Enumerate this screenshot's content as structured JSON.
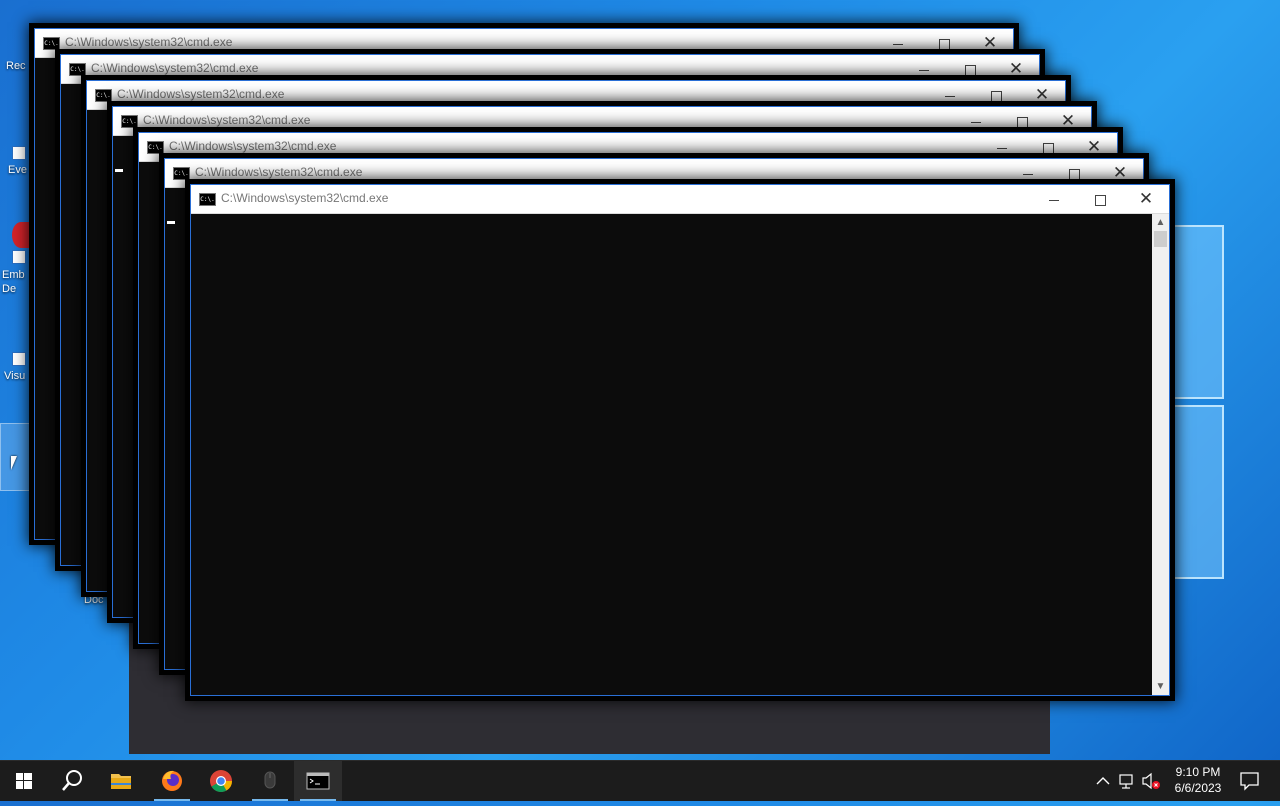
{
  "desktop": {
    "icons": [
      {
        "label": "Rec"
      },
      {
        "label": "Eve"
      },
      {
        "label": "Emb De"
      },
      {
        "label": "Visu"
      },
      {
        "label": "Doc"
      }
    ]
  },
  "windows": [
    {
      "title": "C:\\Windows\\system32\\cmd.exe"
    },
    {
      "title": "C:\\Windows\\system32\\cmd.exe"
    },
    {
      "title": "C:\\Windows\\system32\\cmd.exe"
    },
    {
      "title": "C:\\Windows\\system32\\cmd.exe"
    },
    {
      "title": "C:\\Windows\\system32\\cmd.exe"
    },
    {
      "title": "C:\\Windows\\system32\\cmd.exe"
    },
    {
      "title": "C:\\Windows\\system32\\cmd.exe"
    }
  ],
  "window_icon_glyph": "C:\\.",
  "titlebar_buttons": {
    "minimize_icon": "minimize-icon",
    "maximize_icon": "maximize-icon",
    "close_glyph": "✕"
  },
  "scrollbar": {
    "up_glyph": "▲",
    "down_glyph": "▼"
  },
  "taskbar": {
    "items": [
      {
        "name": "start-button",
        "icon": "windows-logo-icon"
      },
      {
        "name": "search-button",
        "icon": "search-icon"
      },
      {
        "name": "file-explorer",
        "icon": "folder-icon"
      },
      {
        "name": "firefox",
        "icon": "firefox-icon"
      },
      {
        "name": "chrome",
        "icon": "chrome-icon"
      },
      {
        "name": "app-mouse",
        "icon": "mouse-icon"
      },
      {
        "name": "command-prompt",
        "icon": "terminal-icon"
      }
    ],
    "tray": {
      "chevron_glyph": "^",
      "time": "9:10 PM",
      "date": "6/6/2023"
    }
  },
  "colors": {
    "accent": "#2a6fd6",
    "console_bg": "#0c0c0c",
    "taskbar_bg": "#1c1c1c",
    "running_indicator": "#76b9ed"
  }
}
